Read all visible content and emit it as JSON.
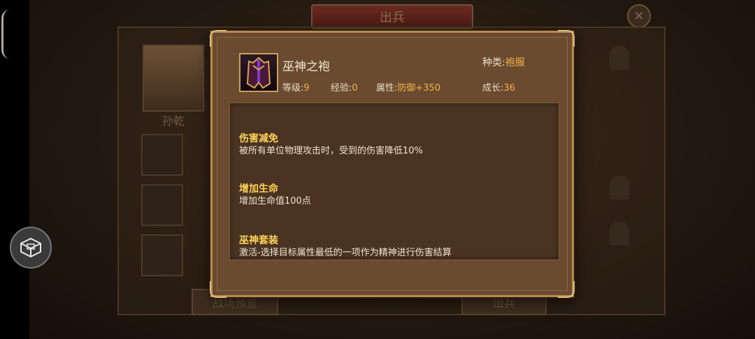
{
  "background": {
    "title": "出兵",
    "close_icon": "close-icon",
    "hero_name": "孙乾",
    "left_button": "战场预览",
    "right_button": "出兵"
  },
  "item": {
    "name": "巫神之袍",
    "type_label": "种类:",
    "type_value": "袍服",
    "level_label": "等级:",
    "level_value": "9",
    "exp_label": "经验:",
    "exp_value": "0",
    "attr_label": "属性:",
    "attr_value": "防御+350",
    "growth_label": "成长:",
    "growth_value": "36"
  },
  "sections": [
    {
      "title": "伤害减免",
      "desc": "被所有单位物理攻击时，受到的伤害降低10%"
    },
    {
      "title": "增加生命",
      "desc": "增加生命值100点"
    },
    {
      "title": "巫神套装",
      "desc": "激活-选择目标属性最低的一项作为精神进行伤害结算"
    }
  ],
  "colors": {
    "accent": "#f0b24a",
    "section_title": "#ffd35a",
    "panel": "#6b4b2f"
  }
}
